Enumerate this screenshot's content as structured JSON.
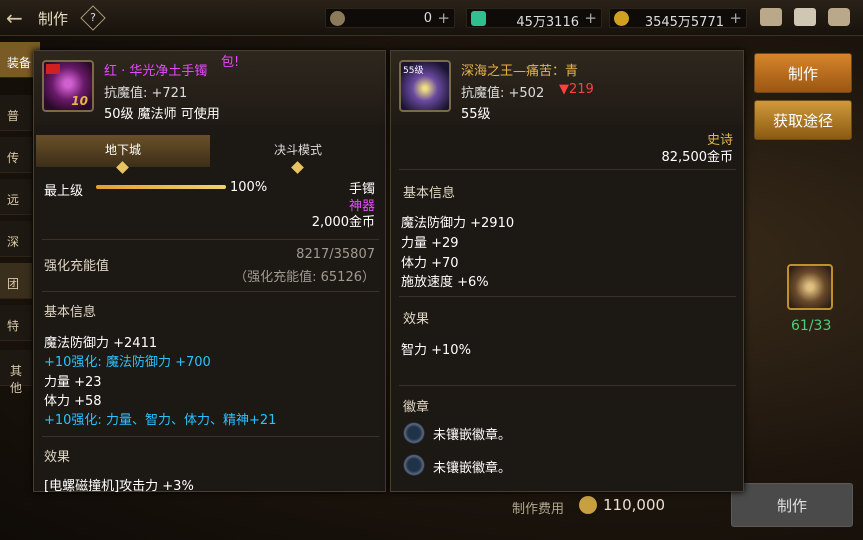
{
  "topbar": {
    "title": "制作",
    "currencies": [
      {
        "value": "0",
        "color": "#b8a070"
      },
      {
        "value": "45万3116",
        "color": "#30c090"
      },
      {
        "value": "3545万5771",
        "color": "#d0a020"
      }
    ]
  },
  "sidebar": {
    "items": [
      {
        "label": "装备"
      },
      {
        "label": "普"
      },
      {
        "label": "传"
      },
      {
        "label": "远"
      },
      {
        "label": "深"
      },
      {
        "label": "团"
      },
      {
        "label": "特"
      },
      {
        "label": "其他"
      }
    ]
  },
  "left": {
    "name": "红 · 华光净土手镯",
    "extra": "包!",
    "resist": "抗魔值: +721",
    "level_req": "50级 魔法师 可使用",
    "icon_num": "10",
    "tabs": [
      "地下城",
      "决斗模式"
    ],
    "max_label": "最上级",
    "max_pct": "100%",
    "max_fill": 1.0,
    "slot": "手镯",
    "rarity": "神器",
    "price": "2,000金币",
    "enh_label": "强化充能值",
    "enh_val": "8217/35807",
    "enh_sub": "（强化充能值: 65126）",
    "basic_head": "基本信息",
    "stats": [
      "魔法防御力 +2411",
      "+10强化: 魔法防御力 +700",
      "力量 +23",
      "体力 +58",
      "+10强化: 力量、智力、体力、精神+21"
    ],
    "effect_head": "效果",
    "effect_line": "[电螺磁撞机]攻击力 +3%"
  },
  "right": {
    "name": "深海之王—痛苦：青",
    "resist": "抗魔值: +502",
    "resist_diff": "▼219",
    "level": "55级",
    "icon_lv": "55级",
    "rarity": "史诗",
    "price": "82,500金币",
    "basic_head": "基本信息",
    "stats": [
      "魔法防御力 +2910",
      "力量 +29",
      "体力 +70",
      "施放速度 +6%"
    ],
    "effect_head": "效果",
    "effect_line": "智力 +10%",
    "badge_head": "徽章",
    "badges": [
      "未镶嵌徽章。",
      "未镶嵌徽章。"
    ]
  },
  "buttons": {
    "make": "制作",
    "source": "获取途径",
    "make_bottom": "制作"
  },
  "material": {
    "count": "61/33"
  },
  "cost": {
    "label": "制作费用",
    "value": "110,000"
  }
}
